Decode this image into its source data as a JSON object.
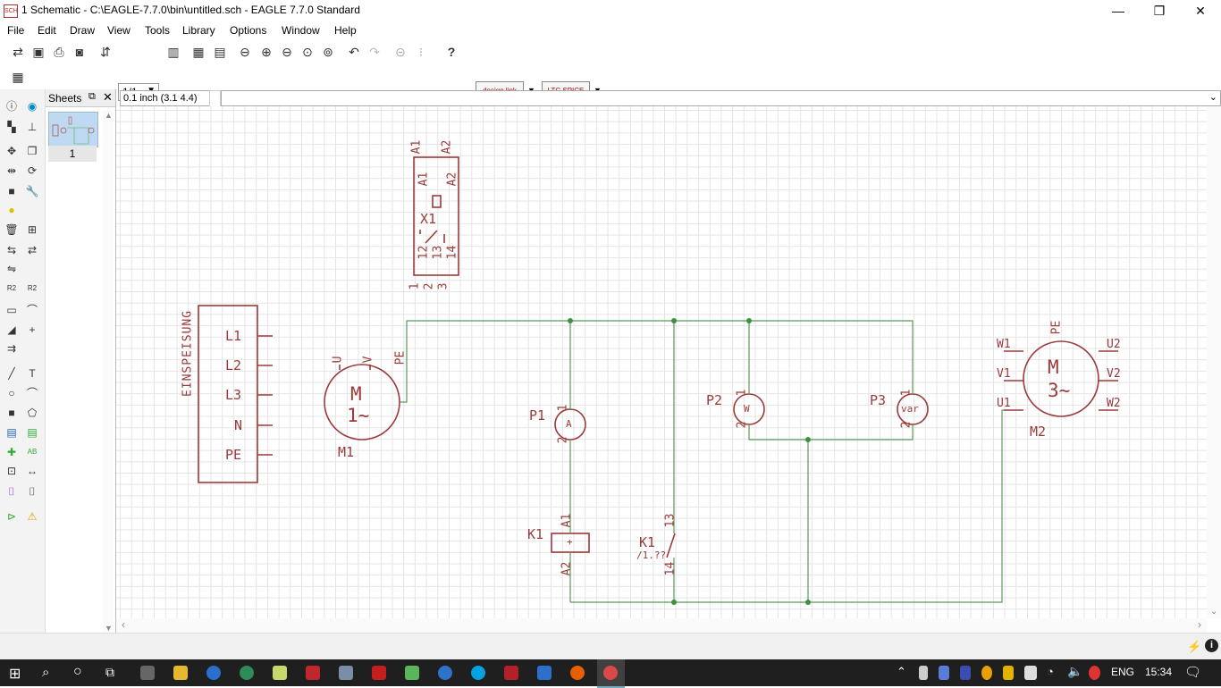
{
  "window": {
    "title": "1 Schematic - C:\\EAGLE-7.7.0\\bin\\untitled.sch - EAGLE 7.7.0 Standard",
    "minimize": "—",
    "restore": "❐",
    "close": "✕"
  },
  "menu": [
    "File",
    "Edit",
    "Draw",
    "View",
    "Tools",
    "Library",
    "Options",
    "Window",
    "Help"
  ],
  "toolbar": {
    "sheet_select": "1/1",
    "designlink_label": "design link",
    "ltspice_label": "LTC SPICE"
  },
  "sheets_panel": {
    "title": "Sheets",
    "sheet_number": "1"
  },
  "coord_display": "0.1 inch (3.1 4.4)",
  "command_line": "",
  "schematic": {
    "einspeisung": {
      "name": "EINSPEISUNG",
      "pins": [
        "L1",
        "L2",
        "L3",
        "N",
        "PE"
      ]
    },
    "m1": {
      "name": "M1",
      "label_top": "M",
      "label_bottom": "1~",
      "pin_u": "U",
      "pin_v": "V",
      "pin_pe": "PE"
    },
    "x1": {
      "name": "X1",
      "pins_top": [
        "A1",
        "A2"
      ],
      "pins_mid": [
        "A1",
        "A2"
      ],
      "pins_low": [
        "12",
        "13",
        "14"
      ],
      "pins_bottom": [
        "1",
        "2",
        "3"
      ]
    },
    "p1": {
      "name": "P1",
      "symbol": "A",
      "pin1": "1",
      "pin2": "2"
    },
    "p2": {
      "name": "P2",
      "symbol": "W",
      "pin1": "1",
      "pin2": "2"
    },
    "p3": {
      "name": "P3",
      "symbol": "var",
      "pin1": "1",
      "pin2": "2"
    },
    "k1_coil": {
      "name": "K1",
      "pin_a1": "A1",
      "pin_a2": "A2"
    },
    "k1_contact": {
      "name": "K1",
      "ref": "/1.??",
      "pin13": "13",
      "pin14": "14"
    },
    "m2": {
      "name": "M2",
      "label_top": "M",
      "label_bottom": "3~",
      "pin_pe": "PE",
      "left_pins": [
        "W1",
        "V1",
        "U1"
      ],
      "right_pins": [
        "U2",
        "V2",
        "W2"
      ]
    }
  },
  "taskbar": {
    "language": "ENG",
    "time": "15:34"
  },
  "colors": {
    "symbol": "#9b3a3a",
    "net": "#5a9a5a",
    "junction": "#3f8f3f",
    "grid": "#e4e4e4"
  }
}
